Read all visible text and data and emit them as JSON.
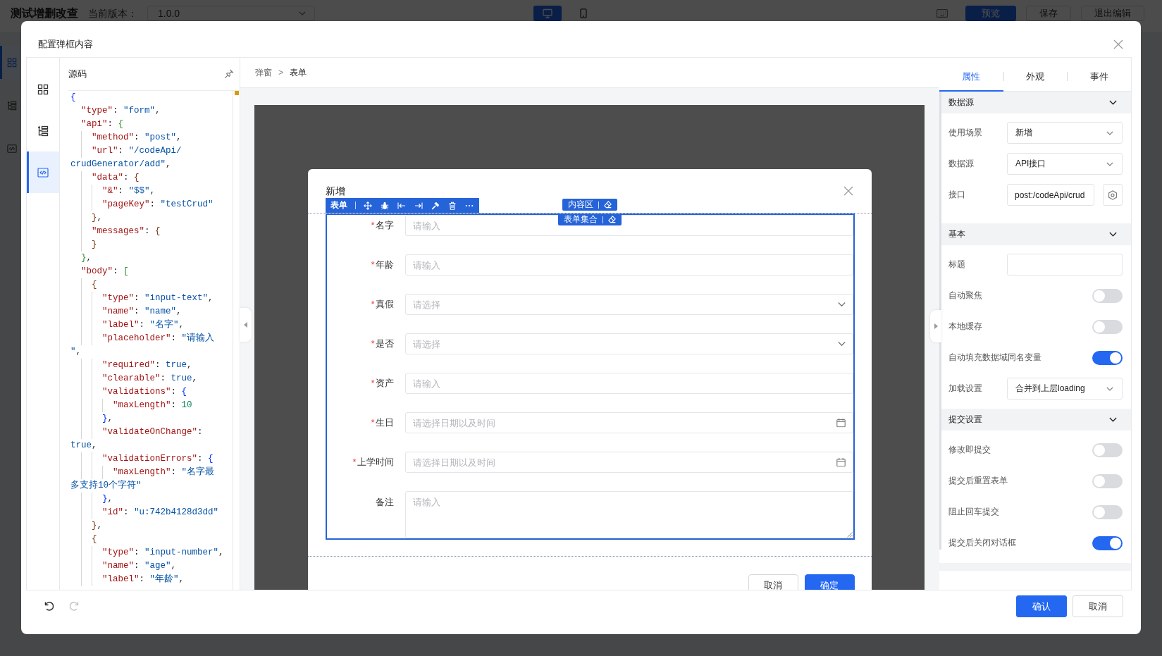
{
  "background": {
    "title": "测试增删改查",
    "version_label": "当前版本：",
    "version": "1.0.0",
    "devices": [
      {
        "kind": "desktop",
        "selected": true
      },
      {
        "kind": "mobile",
        "selected": false
      }
    ],
    "actions": [
      {
        "label": "预览",
        "kind": "primary"
      },
      {
        "label": "保存",
        "kind": "default"
      },
      {
        "label": "退出编辑",
        "kind": "default"
      }
    ],
    "nav": [
      {
        "kind": "grid",
        "selected": true
      },
      {
        "kind": "tree",
        "selected": false
      },
      {
        "kind": "code",
        "selected": false
      }
    ]
  },
  "dialog": {
    "title": "配置弹框内容",
    "rail": [
      {
        "kind": "grid",
        "selected": false
      },
      {
        "kind": "tree",
        "selected": false
      },
      {
        "kind": "code",
        "selected": true
      }
    ],
    "source": {
      "title": "源码",
      "lines": [
        "{",
        "  \"type\": \"form\",",
        "  \"api\": {",
        "    \"method\": \"post\",",
        "    \"url\": \"/codeApi/",
        "crudGenerator/add\",",
        "    \"data\": {",
        "      \"&\": \"$$\",",
        "      \"pageKey\": \"testCrud\"",
        "    },",
        "    \"messages\": {",
        "    }",
        "  },",
        "  \"body\": [",
        "    {",
        "      \"type\": \"input-text\",",
        "      \"name\": \"name\",",
        "      \"label\": \"名字\",",
        "      \"placeholder\": \"请输入",
        "\",",
        "      \"required\": true,",
        "      \"clearable\": true,",
        "      \"validations\": {",
        "        \"maxLength\": 10",
        "      },",
        "      \"validateOnChange\":",
        "true,",
        "      \"validationErrors\": {",
        "        \"maxLength\": \"名字最",
        "多支持10个字符\"",
        "      },",
        "      \"id\": \"u:742b4128d3dd\"",
        "    },",
        "    {",
        "      \"type\": \"input-number\",",
        "      \"name\": \"age\",",
        "      \"label\": \"年龄\","
      ]
    },
    "breadcrumb": {
      "items": [
        "弹窗",
        "表单"
      ],
      "separator": ">"
    },
    "preview": {
      "title": "新增",
      "toolbar_label": "表单",
      "badges": [
        "内容区",
        "表单集合"
      ],
      "required_mark": "*",
      "fields": [
        {
          "label": "名字",
          "required": true,
          "kind": "input",
          "placeholder": "请输入"
        },
        {
          "label": "年龄",
          "required": true,
          "kind": "input",
          "placeholder": "请输入"
        },
        {
          "label": "真假",
          "required": true,
          "kind": "select",
          "placeholder": "请选择"
        },
        {
          "label": "是否",
          "required": true,
          "kind": "select",
          "placeholder": "请选择"
        },
        {
          "label": "资产",
          "required": true,
          "kind": "input",
          "placeholder": "请输入"
        },
        {
          "label": "生日",
          "required": true,
          "kind": "datetime",
          "placeholder": "请选择日期以及时间"
        },
        {
          "label": "上学时间",
          "required": true,
          "kind": "datetime",
          "placeholder": "请选择日期以及时间"
        },
        {
          "label": "备注",
          "required": false,
          "kind": "textarea",
          "placeholder": "请输入"
        }
      ],
      "buttons": [
        {
          "label": "取消",
          "kind": "default"
        },
        {
          "label": "确定",
          "kind": "primary"
        }
      ]
    },
    "inspector": {
      "tabs": [
        {
          "label": "属性",
          "selected": true
        },
        {
          "label": "外观",
          "selected": false
        },
        {
          "label": "事件",
          "selected": false
        }
      ],
      "sections": [
        {
          "title": "数据源",
          "rows": [
            {
              "kind": "select",
              "label": "使用场景",
              "value": "新增"
            },
            {
              "kind": "select",
              "label": "数据源",
              "value": "API接口"
            },
            {
              "kind": "api",
              "label": "接口",
              "value": "post:/codeApi/crud"
            }
          ]
        },
        {
          "title": "基本",
          "rows": [
            {
              "kind": "input",
              "label": "标题"
            },
            {
              "kind": "switch",
              "label": "自动聚焦",
              "on": false
            },
            {
              "kind": "switch",
              "label": "本地缓存",
              "on": false
            },
            {
              "kind": "switch",
              "label": "自动填充数据域同名变量",
              "on": true
            },
            {
              "kind": "select",
              "label": "加载设置",
              "value": "合并到上层loading"
            }
          ]
        },
        {
          "title": "提交设置",
          "rows": [
            {
              "kind": "switch",
              "label": "修改即提交",
              "on": false
            },
            {
              "kind": "switch",
              "label": "提交后重置表单",
              "on": false
            },
            {
              "kind": "switch",
              "label": "阻止回车提交",
              "on": false
            },
            {
              "kind": "switch",
              "label": "提交后关闭对话框",
              "on": true
            }
          ]
        }
      ]
    },
    "history": [
      {
        "kind": "undo",
        "disabled": false
      },
      {
        "kind": "redo",
        "disabled": true
      }
    ],
    "buttons": [
      {
        "label": "确认",
        "kind": "primary"
      },
      {
        "label": "取消",
        "kind": "default"
      }
    ]
  }
}
